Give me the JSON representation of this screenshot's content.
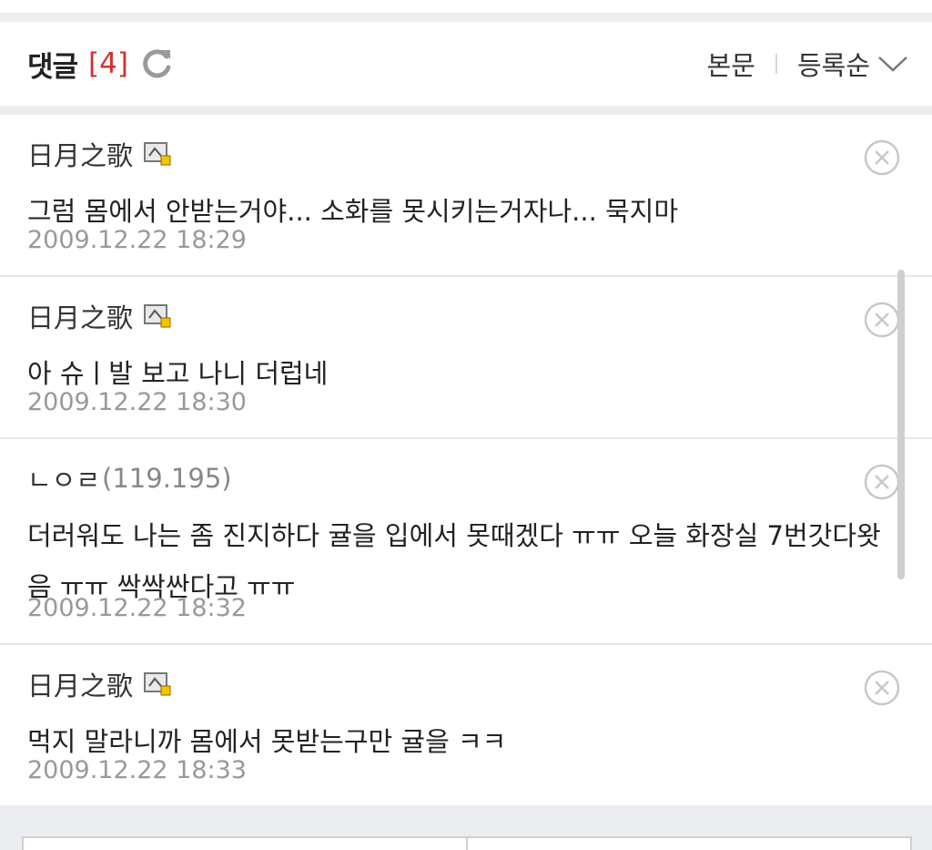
{
  "header": {
    "title": "댓글",
    "count": "[4]",
    "view_original_label": "본문",
    "sort_label": "등록순"
  },
  "comments": [
    {
      "author": "日月之歌",
      "author_ip": "",
      "text": "그럼 몸에서 안받는거야... 소화를 못시키는거자나... 묵지마",
      "date": "2009.12.22 18:29"
    },
    {
      "author": "日月之歌",
      "author_ip": "",
      "text": "아 슈ㅣ발 보고 나니 더럽네",
      "date": "2009.12.22 18:30"
    },
    {
      "author": "ㄴㅇㄹ",
      "author_ip": "(119.195)",
      "text": "더러워도 나는 좀 진지하다 귤을 입에서 못때겠다 ㅠㅠ 오늘 화장실 7번갓다왓음 ㅠㅠ 싹싹싼다고 ㅠㅠ",
      "date": "2009.12.22 18:32"
    },
    {
      "author": "日月之歌",
      "author_ip": "",
      "text": "먹지 말라니까 몸에서 못받는구만 귤을 ㅋㅋ",
      "date": "2009.12.22 18:33"
    }
  ],
  "colors": {
    "accent_count": "#d0312d",
    "date_gray": "#999999",
    "background": "#ebedf0"
  },
  "icons": {
    "refresh": "refresh-icon",
    "sort": "chevron-down-icon",
    "badge": "fixed-nick-badge-icon",
    "delete": "close-circle-icon"
  }
}
